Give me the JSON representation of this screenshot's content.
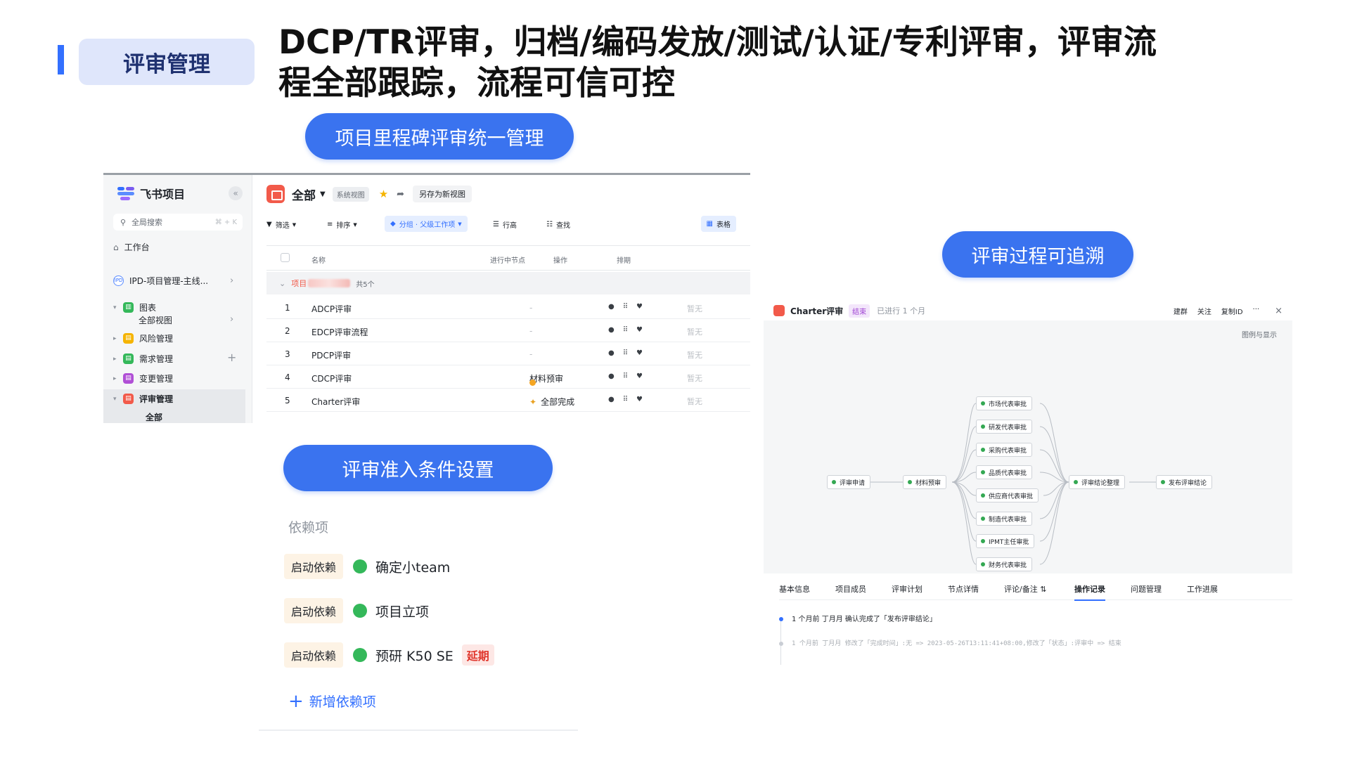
{
  "slide": {
    "tag": "评审管理",
    "headline_line1": "DCP/TR评审，归档/编码发放/测试/认证/专利评审，评审流",
    "headline_line2": "程全部跟踪，流程可信可控",
    "pill_milestone": "项目里程碑评审统一管理",
    "pill_trace": "评审过程可追溯",
    "pill_conditions": "评审准入条件设置"
  },
  "colors": {
    "accent": "#3370ff",
    "pill": "#3a73ef",
    "tag_bg": "#dfe6fb",
    "green": "#34b85a",
    "red": "#e0352b"
  },
  "sidebar": {
    "app_name": "飞书项目",
    "collapse_icon": "«",
    "search_label": "全局搜索",
    "search_shortcut": "⌘ + K",
    "workspace": "工作台",
    "project": "IPD-项目管理-主线...",
    "items": [
      {
        "label": "图表",
        "icon": "chart-icon",
        "color": "#34b85a"
      },
      {
        "label": "全部视图"
      },
      {
        "label": "风险管理",
        "icon": "risk-icon",
        "color": "#f5b400"
      },
      {
        "label": "需求管理",
        "icon": "requirement-icon",
        "color": "#34b85a"
      },
      {
        "label": "变更管理",
        "icon": "change-icon",
        "color": "#b04fd6"
      },
      {
        "label": "评审管理",
        "icon": "review-icon",
        "color": "#f25a4a"
      },
      {
        "label": "全部"
      }
    ]
  },
  "list_view": {
    "title": "全部",
    "system_view_chip": "系统视图",
    "save_as": "另存为新视图",
    "toolbar": {
      "filter": "筛选",
      "sort": "排序",
      "group": "分组 · 父级工作项",
      "row_height": "行高",
      "find": "查找",
      "table": "表格"
    },
    "columns": [
      "名称",
      "进行中节点",
      "操作",
      "排期"
    ],
    "group_prefix": "项目",
    "group_count": "共5个",
    "rows": [
      {
        "num": "1",
        "name": "ADCP评审",
        "node": "-",
        "schedule": "暂无"
      },
      {
        "num": "2",
        "name": "EDCP评审流程",
        "node": "-",
        "schedule": "暂无"
      },
      {
        "num": "3",
        "name": "PDCP评审",
        "node": "-",
        "schedule": "暂无"
      },
      {
        "num": "4",
        "name": "CDCP评审",
        "node": "材料预审",
        "schedule": "暂无"
      },
      {
        "num": "5",
        "name": "Charter评审",
        "node": "全部完成",
        "schedule": "暂无"
      }
    ]
  },
  "flow_view": {
    "title": "Charter评审",
    "status_badge": "结束",
    "elapsed": "已进行 1 个月",
    "actions": [
      "建群",
      "关注",
      "复制ID",
      "···"
    ],
    "close": "×",
    "legend_link": "图例与显示",
    "nodes": {
      "start": "评审申请",
      "pre": "材料预审",
      "approvals": [
        "市场代表审批",
        "研发代表审批",
        "采购代表审批",
        "品质代表审批",
        "供应商代表审批",
        "制造代表审批",
        "IPMT主任审批",
        "财务代表审批"
      ],
      "summary": "评审结论整理",
      "publish": "发布评审结论"
    },
    "tabs": [
      "基本信息",
      "项目成员",
      "评审计划",
      "节点详情",
      "评论/备注 ⇅",
      "操作记录",
      "问题管理",
      "工作进展"
    ],
    "active_tab": "操作记录",
    "logs": [
      "1 个月前  丁月月   确认完成了「发布评审结论」",
      "1 个月前  丁月月   修改了「完成时间」:无 => 2023-05-26T13:11:41+08:00,修改了「状态」:评审中 => 结束"
    ]
  },
  "dependencies": {
    "title": "依赖项",
    "items": [
      {
        "tag": "启动依赖",
        "name": "确定小team",
        "flag": ""
      },
      {
        "tag": "启动依赖",
        "name": "项目立项",
        "flag": ""
      },
      {
        "tag": "启动依赖",
        "name": "预研 K50 SE",
        "flag": "延期"
      }
    ],
    "add_label": "新增依赖项"
  }
}
